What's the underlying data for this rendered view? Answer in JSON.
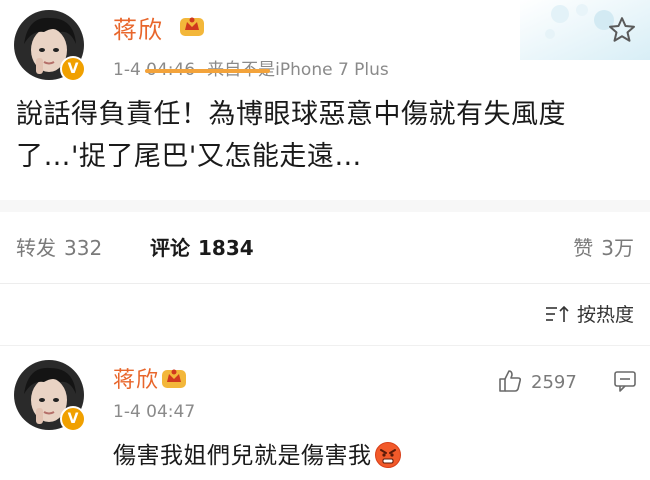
{
  "post": {
    "username": "蒋欣",
    "time": "1-4 04:46",
    "source": "来自不是iPhone 7 Plus",
    "text_lines": [
      "說話得負責任！為博眼球惡意中傷就有失風度",
      "了…'捉了尾巴'又怎能走遠…"
    ]
  },
  "actions": {
    "repost_label": "转发",
    "repost_count": "332",
    "comment_label": "评论",
    "comment_count": "1834",
    "like_label": "赞",
    "like_count": "3万"
  },
  "sort": {
    "label": "按热度"
  },
  "comment": {
    "username": "蒋欣",
    "time": "1-4 04:47",
    "likes": "2597",
    "text": "傷害我姐們兒就是傷害我"
  },
  "icons": {
    "verified": "verified-v-icon",
    "member": "crown-member-icon",
    "sort": "sort-icon",
    "like": "thumbs-up-icon",
    "reply": "comment-icon",
    "emoji": "angry-face-emoji"
  },
  "colors": {
    "username": "#e8662b",
    "accent_underline": "#f3a33b",
    "verified_badge": "#f0a000",
    "meta_text": "#8a8a8a"
  }
}
